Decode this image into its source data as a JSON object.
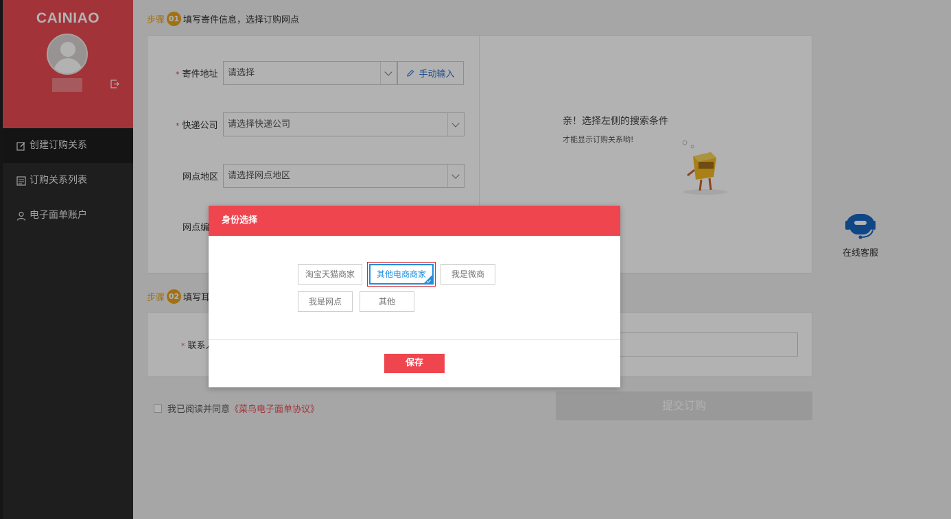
{
  "sidebar": {
    "logo": "CAINIAO",
    "nav": [
      {
        "label": "创建订购关系",
        "icon": "edit-icon",
        "active": true
      },
      {
        "label": "订购关系列表",
        "icon": "list-icon",
        "active": false
      },
      {
        "label": "电子面单账户",
        "icon": "user-icon",
        "active": false
      }
    ]
  },
  "step1": {
    "label": "步骤",
    "num": "01",
    "title": "填写寄件信息，选择订购网点"
  },
  "form": {
    "address_label": "寄件地址",
    "address_placeholder": "请选择",
    "manual_input": "手动输入",
    "courier_label": "快递公司",
    "courier_placeholder": "请选择快递公司",
    "region_label": "网点地区",
    "region_placeholder": "请选择网点地区",
    "code_label": "网点编"
  },
  "empty_state": {
    "title": "亲！选择左侧的搜索条件",
    "subtitle": "才能显示订购关系哟!"
  },
  "step2": {
    "label": "步骤",
    "num": "02",
    "title": "填写耳"
  },
  "contact_label": "联系人",
  "service": {
    "label": "在线客服"
  },
  "agreement": {
    "text": "我已阅读并同意",
    "link": "《菜鸟电子面单协议》"
  },
  "submit_label": "提交订购",
  "modal": {
    "title": "身份选择",
    "options": [
      "淘宝天猫商家",
      "其他电商商家",
      "我是微商",
      "我是网点",
      "其他"
    ],
    "selected": "其他电商商家",
    "save_label": "保存"
  },
  "colors": {
    "brand_red": "#e84a52",
    "step_orange": "#e8a319",
    "select_blue": "#1e8fe0"
  }
}
